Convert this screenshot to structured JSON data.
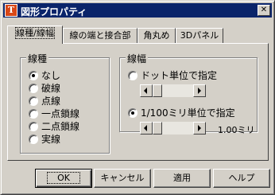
{
  "window": {
    "title": "図形プロパティ",
    "icon_glyph": "T",
    "close_label": "✕"
  },
  "tabs": [
    {
      "label": "線種/線幅",
      "active": true
    },
    {
      "label": "線の端と接合部",
      "active": false
    },
    {
      "label": "角丸め",
      "active": false
    },
    {
      "label": "3Dパネル",
      "active": false
    }
  ],
  "line_type": {
    "group_title": "線種",
    "options": [
      "なし",
      "破線",
      "点線",
      "一点鎖線",
      "二点鎖線",
      "実線"
    ],
    "selected": "なし"
  },
  "line_width": {
    "group_title": "線幅",
    "dot_option_label": "ドット単位で指定",
    "mm_option_label": "1/100ミリ単位で指定",
    "selected": "1/100ミリ単位で指定",
    "mm_value_text": "1.00ミリ"
  },
  "buttons": {
    "ok": "OK",
    "cancel": "キャンセル",
    "apply": "適用",
    "help": "ヘルプ"
  },
  "colors": {
    "titlebar": "#0a246a",
    "face": "#d4d0c8"
  }
}
